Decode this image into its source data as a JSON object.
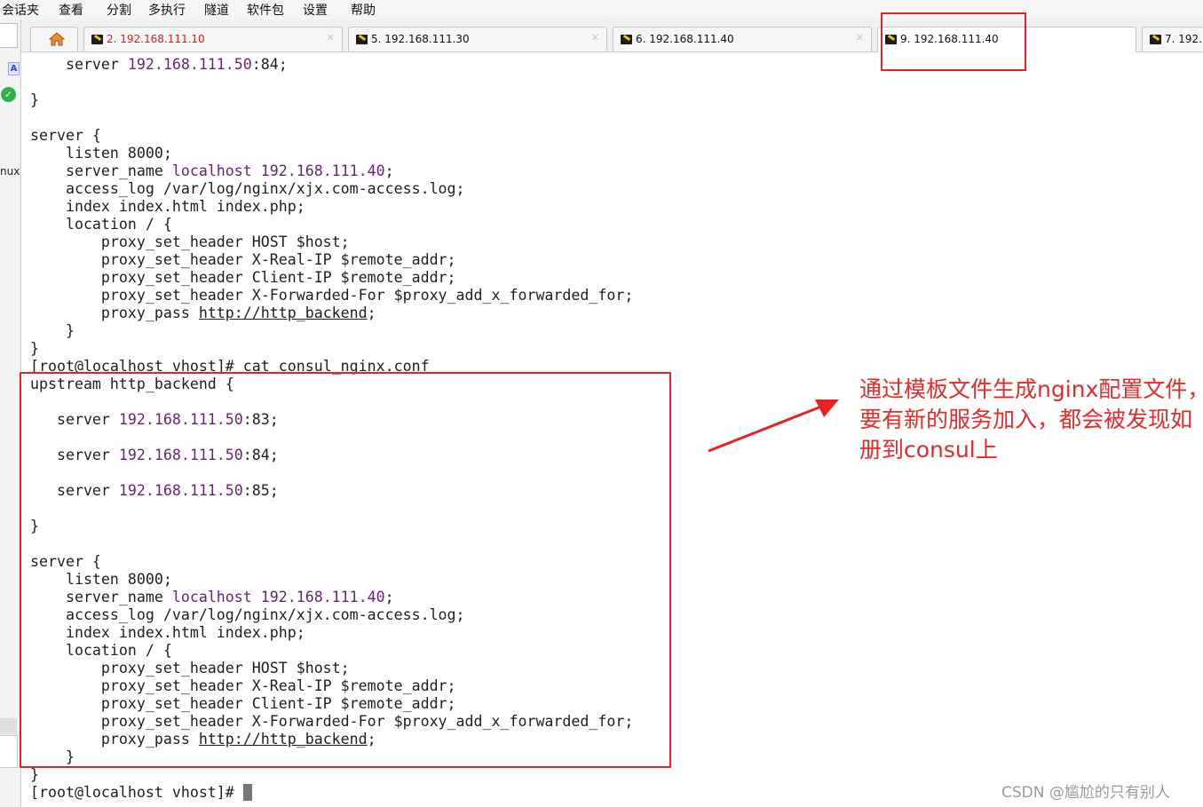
{
  "menu": {
    "items": [
      "会话夹",
      "查看",
      "分割",
      "多执行",
      "隧道",
      "软件包",
      "设置",
      "帮助"
    ]
  },
  "sidebar": {
    "partial_label": "nux"
  },
  "tabs": [
    {
      "label": "2. 192.168.111.10",
      "color": "#d11f1f"
    },
    {
      "label": "5. 192.168.111.30"
    },
    {
      "label": "6. 192.168.111.40"
    },
    {
      "label": "9. 192.168.111.40",
      "active": true
    },
    {
      "label": "7. 192."
    }
  ],
  "terminal": {
    "lines": [
      [
        {
          "t": "    server "
        },
        {
          "t": "192.168.111.50",
          "c": "ip"
        },
        {
          "t": ":84;"
        }
      ],
      [],
      [
        {
          "t": "}"
        }
      ],
      [],
      [
        {
          "t": "server {"
        }
      ],
      [
        {
          "t": "    listen 8000;"
        }
      ],
      [
        {
          "t": "    server_name "
        },
        {
          "t": "localhost 192.168.111.40",
          "c": "ip"
        },
        {
          "t": ";"
        }
      ],
      [
        {
          "t": "    access_log /var/log/nginx/xjx.com-access.log;"
        }
      ],
      [
        {
          "t": "    index index.html index.php;"
        }
      ],
      [
        {
          "t": "    location / {"
        }
      ],
      [
        {
          "t": "        proxy_set_header HOST $host;"
        }
      ],
      [
        {
          "t": "        proxy_set_header X-Real-IP $remote_addr;"
        }
      ],
      [
        {
          "t": "        proxy_set_header Client-IP $remote_addr;"
        }
      ],
      [
        {
          "t": "        proxy_set_header X-Forwarded-For $proxy_add_x_forwarded_for;"
        }
      ],
      [
        {
          "t": "        proxy_pass "
        },
        {
          "t": "http://http_backend",
          "c": "u"
        },
        {
          "t": ";"
        }
      ],
      [
        {
          "t": "    }"
        }
      ],
      [
        {
          "t": "}"
        }
      ],
      [
        {
          "t": "[root@"
        },
        {
          "t": "localhost",
          "c": "u"
        },
        {
          "t": " vhost]# cat consul_nginx.conf"
        }
      ],
      [
        {
          "t": "upstream http_backend {"
        }
      ],
      [],
      [
        {
          "t": "   server "
        },
        {
          "t": "192.168.111.50",
          "c": "ip"
        },
        {
          "t": ":83;"
        }
      ],
      [],
      [
        {
          "t": "   server "
        },
        {
          "t": "192.168.111.50",
          "c": "ip"
        },
        {
          "t": ":84;"
        }
      ],
      [],
      [
        {
          "t": "   server "
        },
        {
          "t": "192.168.111.50",
          "c": "ip"
        },
        {
          "t": ":85;"
        }
      ],
      [],
      [
        {
          "t": "}"
        }
      ],
      [],
      [
        {
          "t": "server {"
        }
      ],
      [
        {
          "t": "    listen 8000;"
        }
      ],
      [
        {
          "t": "    server_name "
        },
        {
          "t": "localhost 192.168.111.40",
          "c": "ip"
        },
        {
          "t": ";"
        }
      ],
      [
        {
          "t": "    access_log /var/log/nginx/xjx.com-access.log;"
        }
      ],
      [
        {
          "t": "    index index.html index.php;"
        }
      ],
      [
        {
          "t": "    location / {"
        }
      ],
      [
        {
          "t": "        proxy_set_header HOST $host;"
        }
      ],
      [
        {
          "t": "        proxy_set_header X-Real-IP $remote_addr;"
        }
      ],
      [
        {
          "t": "        proxy_set_header Client-IP $remote_addr;"
        }
      ],
      [
        {
          "t": "        proxy_set_header X-Forwarded-For $proxy_add_x_forwarded_for;"
        }
      ],
      [
        {
          "t": "        proxy_pass "
        },
        {
          "t": "http://http_backend",
          "c": "u"
        },
        {
          "t": ";"
        }
      ],
      [
        {
          "t": "    }"
        }
      ],
      [
        {
          "t": "}"
        }
      ],
      [
        {
          "t": "[root@localhost vhost]# "
        }
      ]
    ]
  },
  "annotation": {
    "lines": [
      "通过模板文件生成nginx配置文件，",
      "要有新的服务加入，都会被发现如",
      "册到consul上"
    ],
    "color": "#e52a2a"
  },
  "watermark": "CSDN @尴尬的只有别人"
}
